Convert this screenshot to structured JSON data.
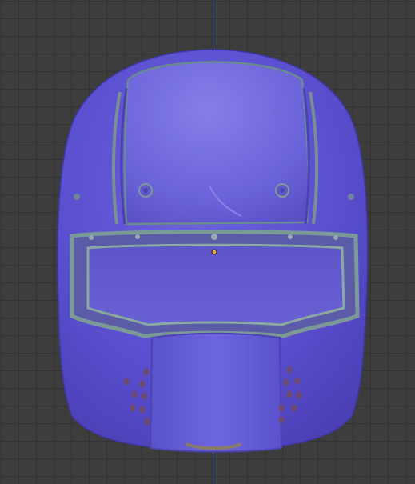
{
  "viewport": {
    "background_color": "#3d3d3d",
    "grid_color": "#323232",
    "axis_color": "#4b78b3"
  },
  "model": {
    "kind": "helmet",
    "shading": "normal-map",
    "base_color": "#5a4fcf",
    "highlight_color": "#7f78e6",
    "edge_color": "#6c8a8c"
  },
  "origin": {
    "color": "#f2a13a"
  }
}
